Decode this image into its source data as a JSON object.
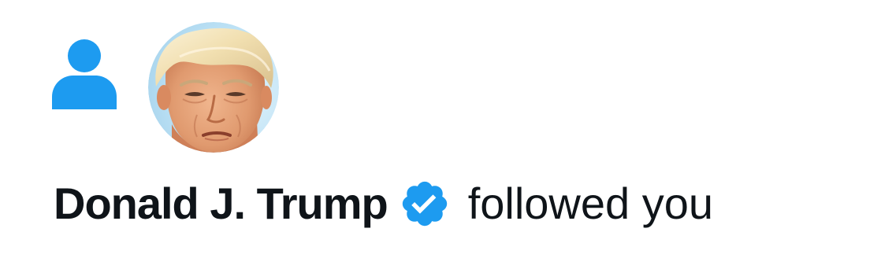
{
  "notification": {
    "type_icon": "person-icon",
    "user": {
      "name": "Donald J. Trump",
      "avatar": "profile-photo",
      "verified_icon": "verified-badge-icon"
    },
    "action_text": "followed you"
  },
  "colors": {
    "accent": "#1d9bf0",
    "text": "#0f1419",
    "background": "#ffffff"
  }
}
